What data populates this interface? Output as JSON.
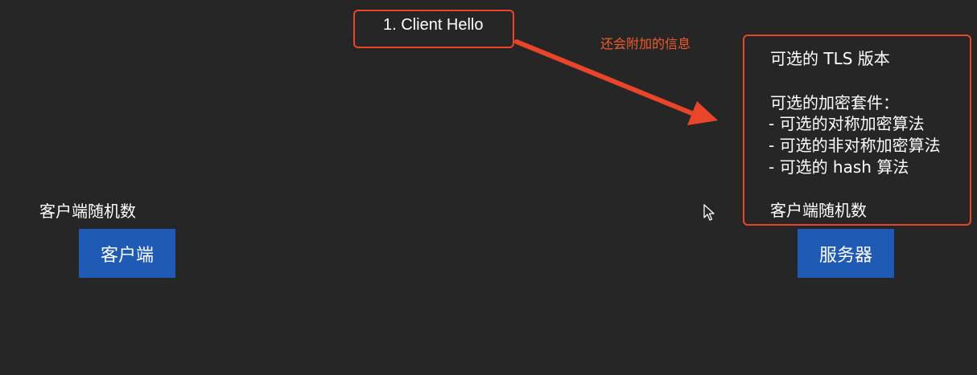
{
  "step": {
    "label": "1. Client Hello"
  },
  "annotation": {
    "text": "还会附加的信息"
  },
  "info_box": {
    "lines": [
      "可选的 TLS 版本",
      "可选的加密套件：",
      "- 可选的对称加密算法",
      "- 可选的非对称加密算法",
      "- 可选的 hash 算法",
      "客户端随机数"
    ]
  },
  "client": {
    "random_label": "客户端随机数",
    "node_label": "客户端"
  },
  "server": {
    "node_label": "服务器"
  },
  "colors": {
    "background": "#262626",
    "highlight": "#e8452a",
    "annotation": "#f05a2a",
    "node": "#1f5bb5"
  },
  "icons": {
    "arrow": "arrow-icon",
    "cursor": "mouse-pointer-icon"
  }
}
